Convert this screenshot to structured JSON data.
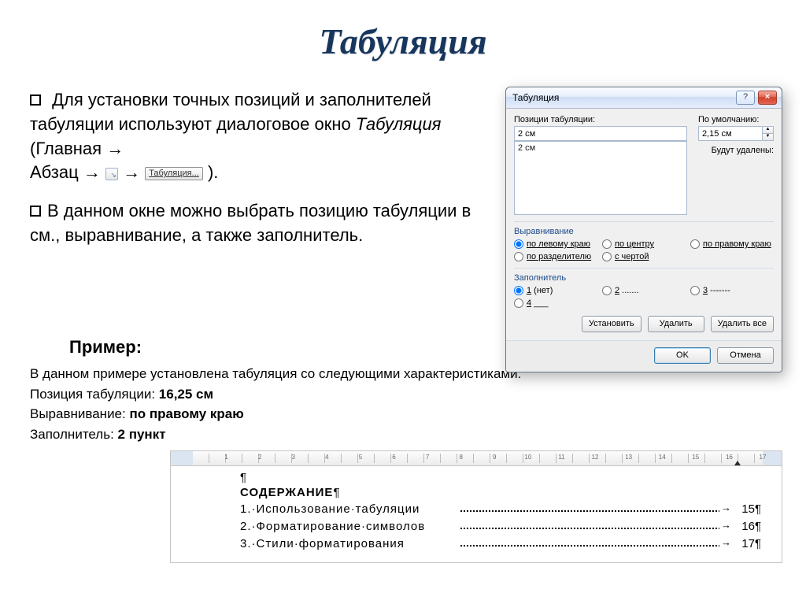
{
  "title": "Табуляция",
  "bullet1": {
    "part1": "Для установки точных позиций и заполнителей табуляции используют диалоговое окно ",
    "italic": "Табуляция",
    "after_italic": " (Главная ",
    "abzac": "Абзац ",
    "tab_btn": "Табуляция...",
    "close": " )."
  },
  "bullet2": "В данном окне можно выбрать позицию табуляции в см., выравнивание, а также заполнитель.",
  "example_label": "Пример:",
  "example": {
    "l1": "В данном примере установлена табуляция со следующими характеристиками:",
    "l2a": "Позиция табуляции: ",
    "l2b": "16,25 см",
    "l3a": "Выравнивание: ",
    "l3b": "по правому краю",
    "l4a": "Заполнитель: ",
    "l4b": "2 пункт"
  },
  "dialog": {
    "title": "Табуляция",
    "positions_label": "Позиции табуляции:",
    "position_value": "2 см",
    "list_item": "2 см",
    "default_label": "По умолчанию:",
    "default_value": "2,15 см",
    "will_delete_label": "Будут удалены:",
    "align_group": "Выравнивание",
    "align_left": "по левому краю",
    "align_center": "по центру",
    "align_right": "по правому краю",
    "align_sep": "по разделителю",
    "align_bar": "с чертой",
    "leader_group": "Заполнитель",
    "leader1": "1 (нет)",
    "leader2": "2 .......",
    "leader3": "3 -------",
    "leader4": "4 ___",
    "btn_set": "Установить",
    "btn_del": "Удалить",
    "btn_delall": "Удалить все",
    "btn_ok": "OK",
    "btn_cancel": "Отмена"
  },
  "sample": {
    "heading": "СОДЕРЖАНИЕ",
    "rows": [
      {
        "n": "1",
        "t": "Использование·табуляции",
        "p": "15"
      },
      {
        "n": "2",
        "t": "Форматирование·символов",
        "p": "16"
      },
      {
        "n": "3",
        "t": "Стили·форматирования",
        "p": "17"
      }
    ],
    "ruler_numbers": [
      "1",
      "2",
      "3",
      "4",
      "5",
      "6",
      "7",
      "8",
      "9",
      "10",
      "11",
      "12",
      "13",
      "14",
      "15",
      "16",
      "17"
    ]
  }
}
